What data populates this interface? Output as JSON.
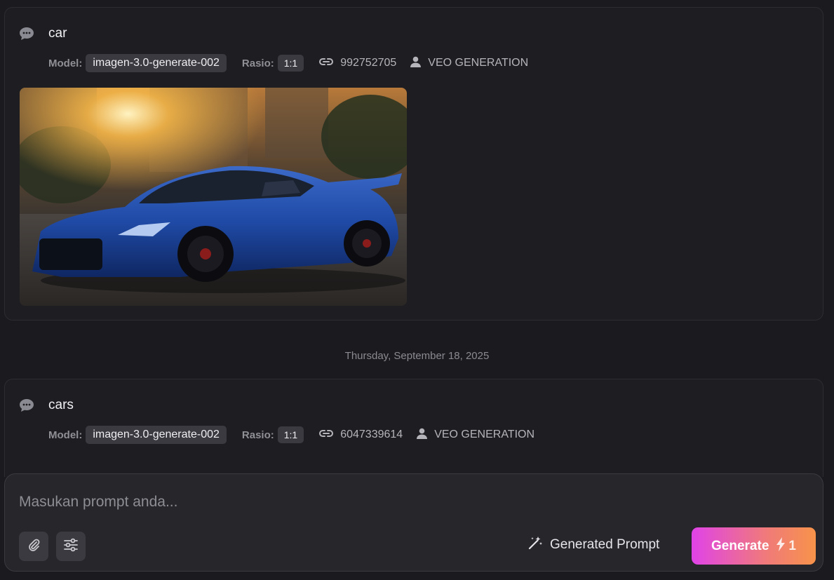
{
  "history": [
    {
      "prompt": "car",
      "model_label": "Model:",
      "model": "imagen-3.0-generate-002",
      "ratio_label": "Rasio:",
      "ratio": "1:1",
      "seed": "992752705",
      "user": "VEO GENERATION"
    },
    {
      "prompt": "cars",
      "model_label": "Model:",
      "model": "imagen-3.0-generate-002",
      "ratio_label": "Rasio:",
      "ratio": "1:1",
      "seed": "6047339614",
      "user": "VEO GENERATION"
    }
  ],
  "date_separator": "Thursday, September 18, 2025",
  "composer": {
    "placeholder": "Masukan prompt anda...",
    "generated_prompt_label": "Generated Prompt",
    "generate_label": "Generate",
    "credit_cost": "1"
  },
  "icons": {
    "chat": "chat-bubble-icon",
    "seed": "link-icon",
    "user": "user-icon",
    "attach": "paperclip-icon",
    "settings": "sliders-icon",
    "magic": "magic-wand-icon",
    "bolt": "lightning-bolt-icon"
  },
  "colors": {
    "background": "#1b1a1f",
    "card": "#1e1e22",
    "chip": "#3a3a40",
    "generate_gradient_start": "#e043e8",
    "generate_gradient_end": "#f7934a"
  }
}
